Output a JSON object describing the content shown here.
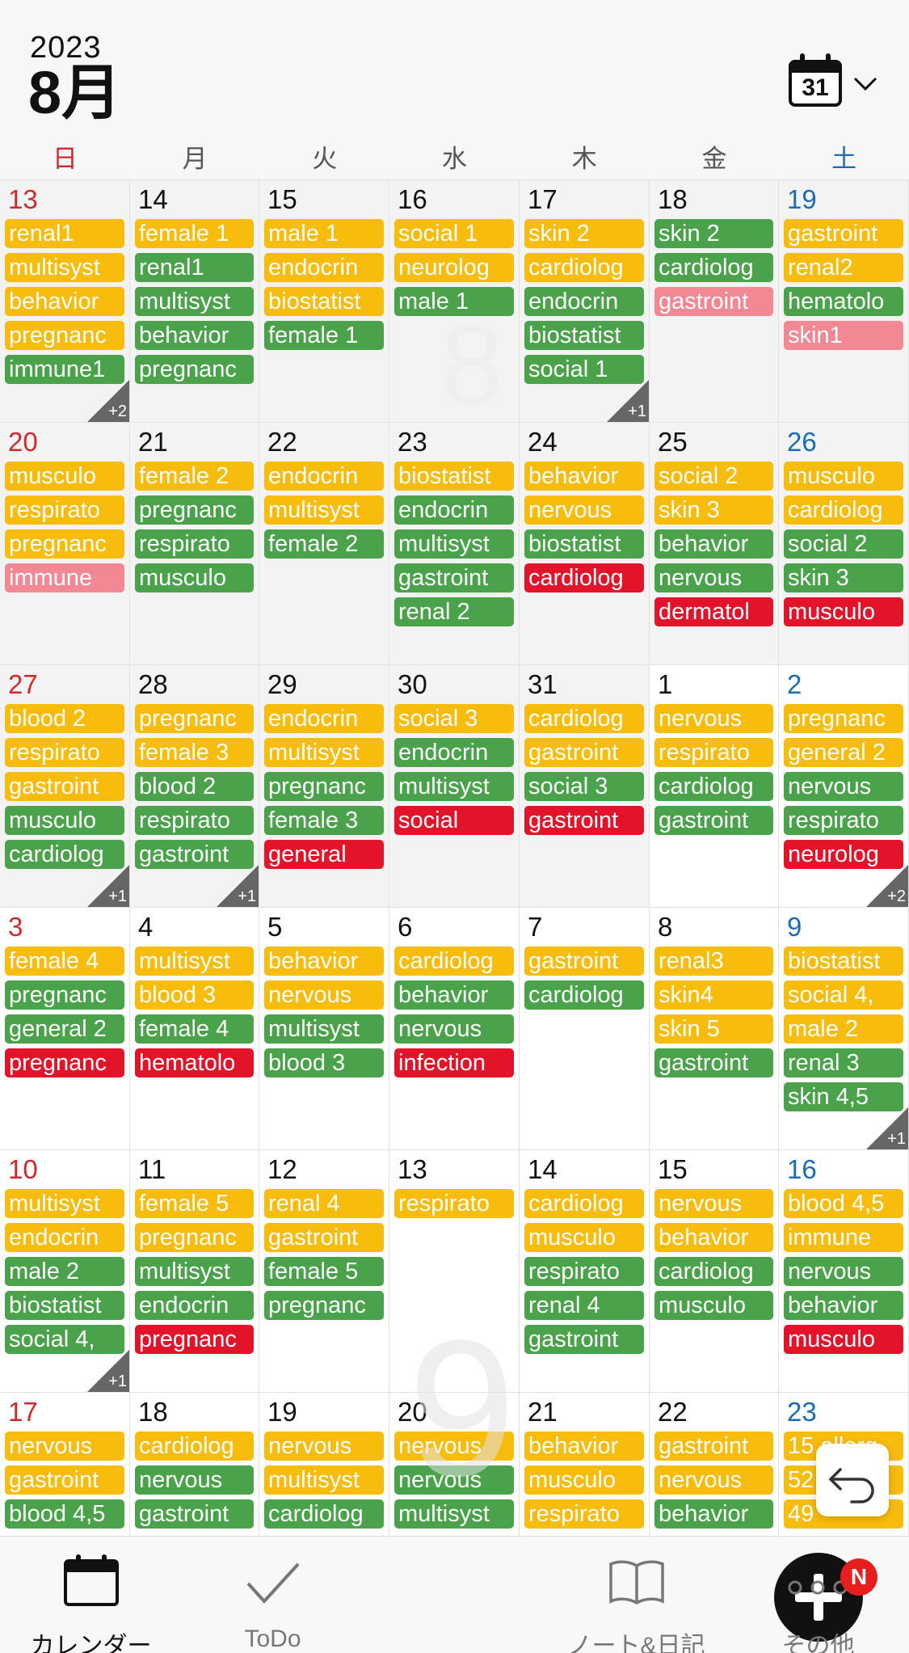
{
  "header": {
    "year": "2023",
    "month": "8月",
    "today_icon_number": "31"
  },
  "weekdays": [
    "日",
    "月",
    "火",
    "水",
    "木",
    "金",
    "土"
  ],
  "colors": {
    "yellow": "#f8bc0c",
    "green": "#4aa34a",
    "red": "#e3142a",
    "pink": "#f28893",
    "sunday": "#d0282b",
    "saturday": "#1a6db4"
  },
  "background_numbers": [
    "8",
    "9"
  ],
  "weeks": [
    {
      "days": [
        {
          "num": "13",
          "past": true,
          "events": [
            [
              "renal1",
              "y"
            ],
            [
              "multisyst",
              "y"
            ],
            [
              "behavior",
              "y"
            ],
            [
              "pregnanc",
              "y"
            ],
            [
              "immune1",
              "g"
            ]
          ],
          "more": "+2"
        },
        {
          "num": "14",
          "past": true,
          "events": [
            [
              "female 1",
              "y"
            ],
            [
              "renal1",
              "g"
            ],
            [
              "multisyst",
              "g"
            ],
            [
              "behavior",
              "g"
            ],
            [
              "pregnanc",
              "g"
            ]
          ]
        },
        {
          "num": "15",
          "past": true,
          "events": [
            [
              "male 1",
              "y"
            ],
            [
              "endocrin",
              "y"
            ],
            [
              "biostatist",
              "y"
            ],
            [
              "female 1",
              "g"
            ]
          ]
        },
        {
          "num": "16",
          "past": true,
          "events": [
            [
              "social 1",
              "y"
            ],
            [
              "neurolog",
              "y"
            ],
            [
              "male 1",
              "g"
            ]
          ]
        },
        {
          "num": "17",
          "past": true,
          "events": [
            [
              "skin 2",
              "y"
            ],
            [
              "cardiolog",
              "y"
            ],
            [
              "endocrin",
              "g"
            ],
            [
              "biostatist",
              "g"
            ],
            [
              "social 1",
              "g"
            ]
          ],
          "more": "+1"
        },
        {
          "num": "18",
          "past": true,
          "events": [
            [
              "skin 2",
              "g"
            ],
            [
              "cardiolog",
              "g"
            ],
            [
              "gastroint",
              "p"
            ]
          ]
        },
        {
          "num": "19",
          "past": true,
          "events": [
            [
              "gastroint",
              "y"
            ],
            [
              "renal2",
              "y"
            ],
            [
              "hematolo",
              "g"
            ],
            [
              "skin1",
              "p"
            ]
          ]
        }
      ]
    },
    {
      "days": [
        {
          "num": "20",
          "past": true,
          "events": [
            [
              "musculo",
              "y"
            ],
            [
              "respirato",
              "y"
            ],
            [
              "pregnanc",
              "y"
            ],
            [
              "immune",
              "p"
            ]
          ]
        },
        {
          "num": "21",
          "past": true,
          "events": [
            [
              "female 2",
              "y"
            ],
            [
              "pregnanc",
              "g"
            ],
            [
              "respirato",
              "g"
            ],
            [
              "musculo",
              "g"
            ]
          ]
        },
        {
          "num": "22",
          "past": true,
          "events": [
            [
              "endocrin",
              "y"
            ],
            [
              "multisyst",
              "y"
            ],
            [
              "female 2",
              "g"
            ]
          ]
        },
        {
          "num": "23",
          "past": true,
          "events": [
            [
              "biostatist",
              "y"
            ],
            [
              "endocrin",
              "g"
            ],
            [
              "multisyst",
              "g"
            ],
            [
              "gastroint",
              "g"
            ],
            [
              "renal 2",
              "g"
            ]
          ]
        },
        {
          "num": "24",
          "past": true,
          "events": [
            [
              "behavior",
              "y"
            ],
            [
              "nervous",
              "y"
            ],
            [
              "biostatist",
              "g"
            ],
            [
              "cardiolog",
              "r"
            ]
          ]
        },
        {
          "num": "25",
          "past": true,
          "events": [
            [
              "social 2",
              "y"
            ],
            [
              "skin 3",
              "y"
            ],
            [
              "behavior",
              "g"
            ],
            [
              "nervous",
              "g"
            ],
            [
              "dermatol",
              "r"
            ]
          ]
        },
        {
          "num": "26",
          "past": true,
          "events": [
            [
              "musculo",
              "y"
            ],
            [
              "cardiolog",
              "y"
            ],
            [
              "social 2",
              "g"
            ],
            [
              "skin 3",
              "g"
            ],
            [
              "musculo",
              "r"
            ]
          ]
        }
      ]
    },
    {
      "days": [
        {
          "num": "27",
          "past": true,
          "events": [
            [
              "blood 2",
              "y"
            ],
            [
              "respirato",
              "y"
            ],
            [
              "gastroint",
              "y"
            ],
            [
              "musculo",
              "g"
            ],
            [
              "cardiolog",
              "g"
            ]
          ],
          "more": "+1"
        },
        {
          "num": "28",
          "past": true,
          "events": [
            [
              "pregnanc",
              "y"
            ],
            [
              "female 3",
              "y"
            ],
            [
              "blood 2",
              "g"
            ],
            [
              "respirato",
              "g"
            ],
            [
              "gastroint",
              "g"
            ]
          ],
          "more": "+1"
        },
        {
          "num": "29",
          "past": true,
          "events": [
            [
              "endocrin",
              "y"
            ],
            [
              "multisyst",
              "y"
            ],
            [
              "pregnanc",
              "g"
            ],
            [
              "female 3",
              "g"
            ],
            [
              "general",
              "r"
            ]
          ]
        },
        {
          "num": "30",
          "past": true,
          "events": [
            [
              "social 3",
              "y"
            ],
            [
              "endocrin",
              "g"
            ],
            [
              "multisyst",
              "g"
            ],
            [
              "social",
              "r"
            ]
          ]
        },
        {
          "num": "31",
          "past": true,
          "events": [
            [
              "cardiolog",
              "y"
            ],
            [
              "gastroint",
              "y"
            ],
            [
              "social 3",
              "g"
            ],
            [
              "gastroint",
              "r"
            ]
          ]
        },
        {
          "num": "1",
          "past": false,
          "events": [
            [
              "nervous",
              "y"
            ],
            [
              "respirato",
              "y"
            ],
            [
              "cardiolog",
              "g"
            ],
            [
              "gastroint",
              "g"
            ]
          ]
        },
        {
          "num": "2",
          "past": false,
          "events": [
            [
              "pregnanc",
              "y"
            ],
            [
              "general 2",
              "y"
            ],
            [
              "nervous",
              "g"
            ],
            [
              "respirato",
              "g"
            ],
            [
              "neurolog",
              "r"
            ]
          ],
          "more": "+2"
        }
      ]
    },
    {
      "days": [
        {
          "num": "3",
          "past": false,
          "events": [
            [
              "female 4",
              "y"
            ],
            [
              "pregnanc",
              "g"
            ],
            [
              "general 2",
              "g"
            ],
            [
              "pregnanc",
              "r"
            ]
          ]
        },
        {
          "num": "4",
          "past": false,
          "events": [
            [
              "multisyst",
              "y"
            ],
            [
              "blood 3",
              "y"
            ],
            [
              "female 4",
              "g"
            ],
            [
              "hematolo",
              "r"
            ]
          ]
        },
        {
          "num": "5",
          "past": false,
          "events": [
            [
              "behavior",
              "y"
            ],
            [
              "nervous",
              "y"
            ],
            [
              "multisyst",
              "g"
            ],
            [
              "blood 3",
              "g"
            ]
          ]
        },
        {
          "num": "6",
          "past": false,
          "events": [
            [
              "cardiolog",
              "y"
            ],
            [
              "behavior",
              "g"
            ],
            [
              "nervous",
              "g"
            ],
            [
              "infection",
              "r"
            ]
          ]
        },
        {
          "num": "7",
          "past": false,
          "events": [
            [
              "gastroint",
              "y"
            ],
            [
              "cardiolog",
              "g"
            ]
          ]
        },
        {
          "num": "8",
          "past": false,
          "events": [
            [
              "renal3",
              "y"
            ],
            [
              "skin4",
              "y"
            ],
            [
              "skin 5",
              "y"
            ],
            [
              "gastroint",
              "g"
            ]
          ]
        },
        {
          "num": "9",
          "past": false,
          "events": [
            [
              "biostatist",
              "y"
            ],
            [
              "social 4,",
              "y"
            ],
            [
              "male 2",
              "y"
            ],
            [
              "renal 3",
              "g"
            ],
            [
              "skin 4,5",
              "g"
            ]
          ],
          "more": "+1"
        }
      ]
    },
    {
      "days": [
        {
          "num": "10",
          "past": false,
          "events": [
            [
              "multisyst",
              "y"
            ],
            [
              "endocrin",
              "y"
            ],
            [
              "male 2",
              "g"
            ],
            [
              "biostatist",
              "g"
            ],
            [
              "social 4,",
              "g"
            ]
          ],
          "more": "+1"
        },
        {
          "num": "11",
          "past": false,
          "events": [
            [
              "female 5",
              "y"
            ],
            [
              "pregnanc",
              "y"
            ],
            [
              "multisyst",
              "g"
            ],
            [
              "endocrin",
              "g"
            ],
            [
              "pregnanc",
              "r"
            ]
          ]
        },
        {
          "num": "12",
          "past": false,
          "events": [
            [
              "renal 4",
              "y"
            ],
            [
              "gastroint",
              "y"
            ],
            [
              "female 5",
              "g"
            ],
            [
              "pregnanc",
              "g"
            ]
          ]
        },
        {
          "num": "13",
          "past": false,
          "events": [
            [
              "respirato",
              "y"
            ]
          ]
        },
        {
          "num": "14",
          "past": false,
          "events": [
            [
              "cardiolog",
              "y"
            ],
            [
              "musculo",
              "y"
            ],
            [
              "respirato",
              "g"
            ],
            [
              "renal 4",
              "g"
            ],
            [
              "gastroint",
              "g"
            ]
          ]
        },
        {
          "num": "15",
          "past": false,
          "events": [
            [
              "nervous",
              "y"
            ],
            [
              "behavior",
              "y"
            ],
            [
              "cardiolog",
              "g"
            ],
            [
              "musculo",
              "g"
            ]
          ]
        },
        {
          "num": "16",
          "past": false,
          "events": [
            [
              "blood 4,5",
              "y"
            ],
            [
              "immune",
              "y"
            ],
            [
              "nervous",
              "g"
            ],
            [
              "behavior",
              "g"
            ],
            [
              "musculo",
              "r"
            ]
          ]
        }
      ]
    },
    {
      "days": [
        {
          "num": "17",
          "past": false,
          "events": [
            [
              "nervous",
              "y"
            ],
            [
              "gastroint",
              "y"
            ],
            [
              "blood 4,5",
              "g"
            ]
          ]
        },
        {
          "num": "18",
          "past": false,
          "events": [
            [
              "cardiolog",
              "y"
            ],
            [
              "nervous",
              "g"
            ],
            [
              "gastroint",
              "g"
            ]
          ]
        },
        {
          "num": "19",
          "past": false,
          "events": [
            [
              "nervous",
              "y"
            ],
            [
              "multisyst",
              "y"
            ],
            [
              "cardiolog",
              "g"
            ]
          ]
        },
        {
          "num": "20",
          "past": false,
          "events": [
            [
              "nervous",
              "y"
            ],
            [
              "nervous",
              "g"
            ],
            [
              "multisyst",
              "g"
            ]
          ]
        },
        {
          "num": "21",
          "past": false,
          "events": [
            [
              "behavior",
              "y"
            ],
            [
              "musculo",
              "y"
            ],
            [
              "respirato",
              "y"
            ]
          ]
        },
        {
          "num": "22",
          "past": false,
          "events": [
            [
              "gastroint",
              "y"
            ],
            [
              "nervous",
              "y"
            ],
            [
              "behavior",
              "g"
            ]
          ]
        },
        {
          "num": "23",
          "past": false,
          "events": [
            [
              "15 allerg",
              "y"
            ],
            [
              "52",
              "y"
            ],
            [
              "49",
              "y"
            ]
          ]
        }
      ]
    }
  ],
  "tabs": [
    {
      "label": "カレンダー",
      "icon": "calendar-icon",
      "active": true
    },
    {
      "label": "ToDo",
      "icon": "check-icon",
      "active": false
    },
    {
      "label": "",
      "icon": "add-icon",
      "active": false
    },
    {
      "label": "ノート&日記",
      "icon": "book-icon",
      "active": false
    },
    {
      "label": "その他",
      "icon": "more-icon",
      "active": false
    }
  ],
  "badge": "N"
}
